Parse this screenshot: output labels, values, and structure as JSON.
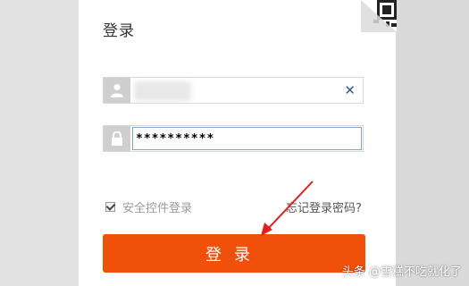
{
  "login": {
    "title": "登录",
    "username_value": "",
    "password_value": "**********",
    "clear_symbol": "✕",
    "secure_login_label": "安全控件登录",
    "secure_login_checked": true,
    "forgot_password_label": "忘记登录密码?",
    "submit_label": "登录"
  },
  "icons": {
    "user": "user-icon",
    "lock": "lock-icon",
    "qr": "qr-code-icon"
  },
  "colors": {
    "accent": "#f0500a",
    "arrow": "#e02020"
  },
  "watermark": {
    "text": "头条 @雪糕不吃就化了"
  }
}
